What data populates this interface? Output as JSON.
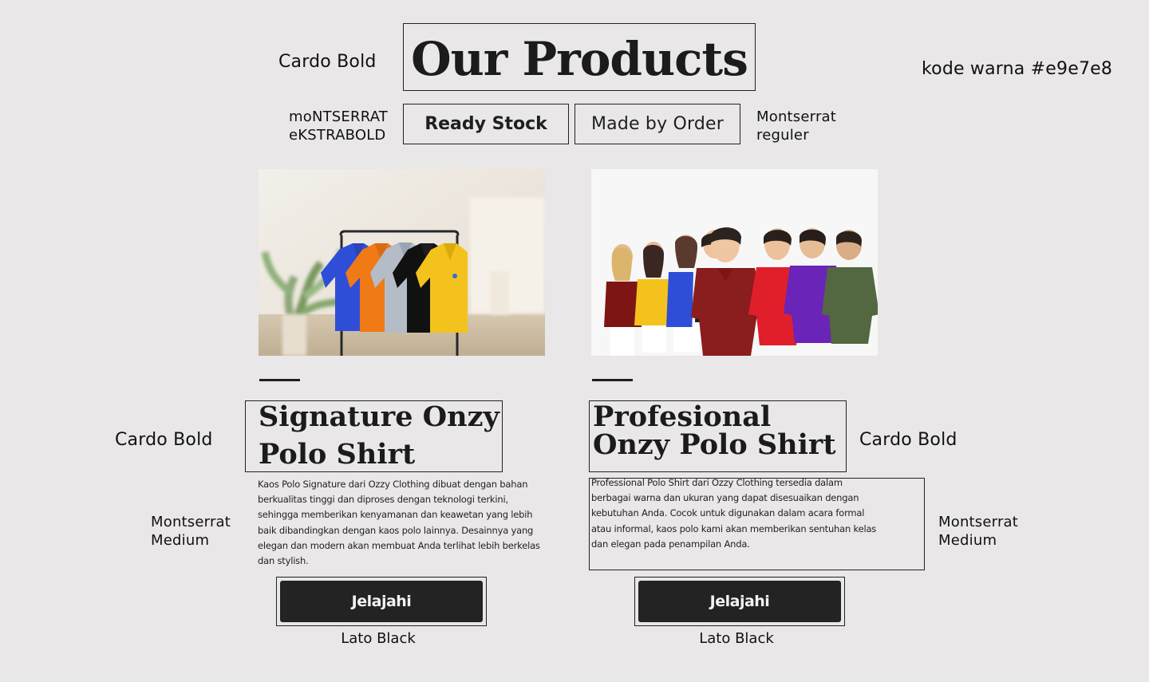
{
  "annotations": {
    "title_font": "Cardo Bold",
    "color_code": "kode warna #e9e7e8",
    "tab_left_font_line1": "moNTSERRAT",
    "tab_left_font_line2": "eKSTRABOLD",
    "tab_right_font_line1": "Montserrat",
    "tab_right_font_line2": "reguler",
    "left_title_font": "Cardo Bold",
    "right_title_font": "Cardo Bold",
    "left_desc_font_line1": "Montserrat",
    "left_desc_font_line2": "Medium",
    "right_desc_font_line1": "Montserrat",
    "right_desc_font_line2": "Medium",
    "left_button_font": "Lato Black",
    "right_button_font": "Lato Black"
  },
  "header": {
    "title": "Our Products"
  },
  "tabs": [
    {
      "label": "Ready Stock"
    },
    {
      "label": "Made by Order"
    }
  ],
  "products": [
    {
      "title_line1": "Signature Onzy",
      "title_line2": "Polo Shirt",
      "desc_lines": [
        "Kaos Polo Signature dari Ozzy Clothing dibuat dengan bahan",
        "berkualitas tinggi dan diproses dengan teknologi terkini,",
        "sehingga memberikan kenyamanan dan keawetan yang lebih",
        "baik dibandingkan dengan kaos polo lainnya. Desainnya yang",
        "elegan dan modern akan membuat Anda terlihat lebih berkelas",
        "dan stylish."
      ],
      "button_label": "Jelajahi",
      "image_icon": "rack-of-polo-shirts-image"
    },
    {
      "title_line1": "Profesional",
      "title_line2": "Onzy Polo Shirt",
      "desc_lines": [
        "Professional Polo Shirt dari Ozzy Clothing tersedia dalam",
        "berbagai warna dan ukuran yang dapat disesuaikan dengan",
        "kebutuhan Anda. Cocok untuk digunakan dalam acara formal",
        "atau informal, kaos polo kami akan memberikan sentuhan kelas",
        "dan elegan pada penampilan Anda."
      ],
      "button_label": "Jelajahi",
      "image_icon": "group-wearing-polo-shirts-image"
    }
  ],
  "colors": {
    "background": "#e9e7e8",
    "dark": "#232323",
    "blue": "#2f4ed8",
    "orange": "#ef7a16",
    "gray": "#b4bcc8",
    "black": "#111111",
    "yellow": "#f4c21c",
    "maroon": "#7d1515",
    "red": "#e01f2b",
    "purple": "#6b24b8",
    "olive": "#536741"
  }
}
